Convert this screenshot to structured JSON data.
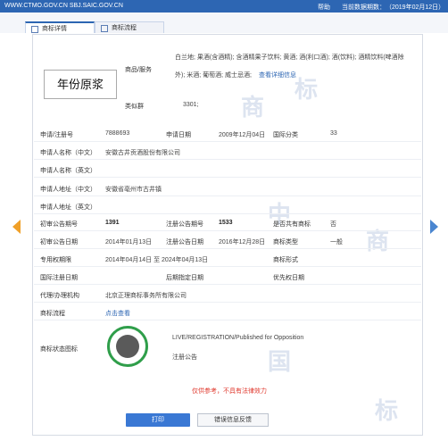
{
  "topbar": {
    "url": "WWW.CTMO.GOV.CN SBJ.SAIC.GOV.CN",
    "help": "帮助",
    "data_date_label": "当前数据期数：",
    "data_date_value": "（2019年02月12日）"
  },
  "tabs": [
    {
      "label": "商标详情"
    },
    {
      "label": "商标流程"
    }
  ],
  "trademark": {
    "logo_text": "年份原浆",
    "goods_label": "商品/服务",
    "goods_line1": "白兰地; 果酒(含酒精); 含酒精果子饮料; 黄酒; 酒(利口酒); 酒(饮料); 酒精饮料(啤酒除",
    "goods_line2_prefix": "外); 米酒; 葡萄酒; 威士忌酒;",
    "goods_more_link": "查看详细信息",
    "similar_group_label": "类似群",
    "similar_group_value": "3301;",
    "app_no_label": "申请/注册号",
    "app_no": "7888693",
    "app_date_label": "申请日期",
    "app_date": "2009年12月04日",
    "intl_class_label": "国际分类",
    "intl_class": "33",
    "applicant_cn_label": "申请人名称（中文）",
    "applicant_cn": "安徽古井贡酒股份有限公司",
    "applicant_en_label": "申请人名称（英文）",
    "addr_cn_label": "申请人地址（中文）",
    "addr_cn": "安徽省亳州市古井镇",
    "addr_en_label": "申请人地址（英文）",
    "prelim_no_label": "初审公告期号",
    "prelim_no": "1391",
    "reg_no_label": "注册公告期号",
    "reg_no": "1533",
    "shared_label": "是否共有商标",
    "shared": "否",
    "prelim_date_label": "初审公告日期",
    "prelim_date": "2014年01月13日",
    "reg_date_label": "注册公告日期",
    "reg_date": "2016年12月28日",
    "tm_type_label": "商标类型",
    "tm_type": "一般",
    "exclusive_label": "专用权期限",
    "exclusive": "2014年04月14日 至 2024年04月13日",
    "tm_form_label": "商标形式",
    "intl_reg_label": "国际注册日期",
    "late_designation_label": "后期指定日期",
    "priority_label": "优先权日期",
    "agent_label": "代理/办理机构",
    "agent": "北京正理商标事务所有限公司",
    "process_label": "商标流程",
    "process_link": "点击查看",
    "status_label": "商标状态图标",
    "status_text": "LIVE/REGISTRATION/Published for Opposition",
    "status_cn": "注册公告",
    "disclaimer": "仅供参考，不具有法律效力"
  },
  "buttons": {
    "print": "打印",
    "feedback": "错误信息反馈"
  },
  "watermark": [
    "中",
    "国",
    "商",
    "标"
  ]
}
